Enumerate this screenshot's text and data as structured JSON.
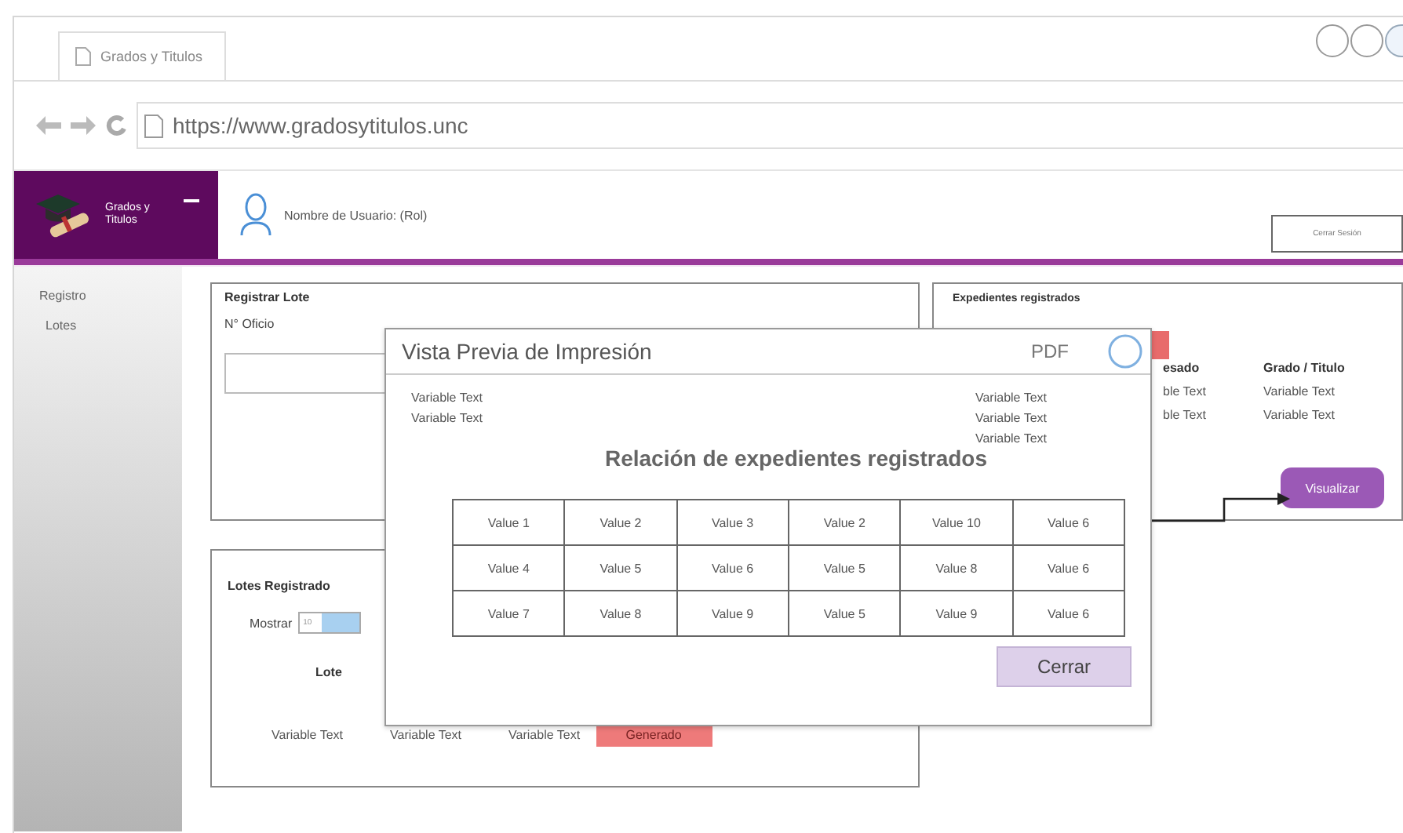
{
  "browser": {
    "tab": "Grados y Titulos",
    "url": "https://www.gradosytitulos.unc"
  },
  "header": {
    "logo_text": "Grados y Titulos",
    "user": "Nombre de Usuario: (Rol)",
    "button": "Cerrar Sesión"
  },
  "sidebar": {
    "items": [
      "Registro",
      "Lotes"
    ]
  },
  "register_panel": {
    "title": "Registrar Lote",
    "field_label": "N° Oficio"
  },
  "records_panel": {
    "title": "Expedientes registrados",
    "columns": [
      "esado",
      "Grado / Titulo"
    ],
    "rows": [
      [
        "ble Text",
        "Variable Text"
      ],
      [
        "ble Text",
        "Variable Text"
      ]
    ],
    "button": "Visualizar"
  },
  "lots_panel": {
    "title": "Lotes Registrado",
    "show_label": "Mostrar",
    "show_value": "10",
    "columns": [
      "Lote"
    ],
    "rows": [
      {
        "cells": [
          "Variable Text",
          "Variable Text",
          "Variable Text"
        ],
        "status": "Generado"
      }
    ]
  },
  "modal": {
    "title": "Vista Previa de Impresión",
    "pdf": "PDF",
    "left_lines": [
      "Variable Text",
      "Variable Text"
    ],
    "right_lines": [
      "Variable Text",
      "Variable Text",
      "Variable Text"
    ],
    "heading": "Relación de expedientes registrados",
    "table": [
      [
        "Value 1",
        "Value 2",
        "Value 3",
        "Value 2",
        "Value 10",
        "Value 6"
      ],
      [
        "Value 4",
        "Value 5",
        "Value 6",
        "Value 5",
        "Value 8",
        "Value 6"
      ],
      [
        "Value 7",
        "Value 8",
        "Value 9",
        "Value 5",
        "Value 9",
        "Value 6"
      ]
    ],
    "close": "Cerrar"
  }
}
